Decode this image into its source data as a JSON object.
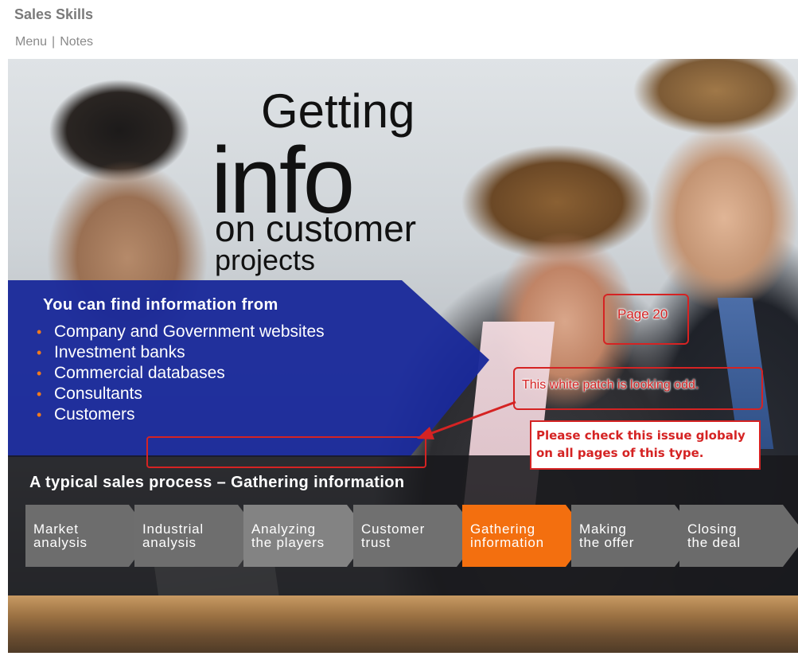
{
  "app": {
    "title": "Sales Skills"
  },
  "topnav": {
    "menu_label": "Menu",
    "separator": "|",
    "notes_label": "Notes"
  },
  "slide": {
    "headline": {
      "line1": "Getting",
      "line2": "info",
      "line3": "on customer",
      "line4": "projects"
    },
    "info_panel": {
      "heading": "You can find information from",
      "items": [
        "Company and Government websites",
        "Investment banks",
        "Commercial databases",
        "Consultants",
        "Customers"
      ]
    },
    "process": {
      "title": "A typical sales process – Gathering information",
      "steps": [
        {
          "line1": "Market",
          "line2": "analysis",
          "active": false
        },
        {
          "line1": "Industrial",
          "line2": "analysis",
          "active": false
        },
        {
          "line1": "Analyzing",
          "line2": "the players",
          "active": false
        },
        {
          "line1": "Customer",
          "line2": "trust",
          "active": false
        },
        {
          "line1": "Gathering",
          "line2": "information",
          "active": true
        },
        {
          "line1": "Making",
          "line2": "the offer",
          "active": false
        },
        {
          "line1": "Closing",
          "line2": "the deal",
          "active": false
        }
      ]
    }
  },
  "annotations": {
    "page_label": "Page 20",
    "patch_comment": "This white patch is looking odd.",
    "global_note": "Please check this issue globaly on all pages of this type.",
    "color": "#d52323"
  },
  "colors": {
    "panel_blue": "#1a2a9a",
    "active_step": "#f36f0f",
    "bullet": "#f07a1e"
  }
}
